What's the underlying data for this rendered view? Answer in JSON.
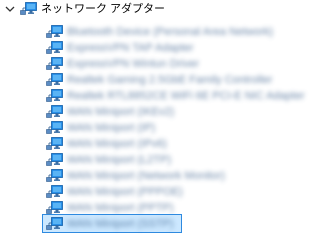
{
  "tree": {
    "root": {
      "label": "ネットワーク アダプター",
      "expanded": true,
      "icon": "network-adapter-icon"
    },
    "children": [
      {
        "label": "Bluetooth Device (Personal Area Network)",
        "icon": "network-adapter-icon",
        "selected": false
      },
      {
        "label": "ExpressVPN TAP Adapter",
        "icon": "network-adapter-icon",
        "selected": false
      },
      {
        "label": "ExpressVPN Wintun Driver",
        "icon": "network-adapter-icon",
        "selected": false
      },
      {
        "label": "Realtek Gaming 2.5GbE Family Controller",
        "icon": "network-adapter-icon",
        "selected": false
      },
      {
        "label": "Realtek RTL8852CE WiFi 6E PCI-E NIC Adapter",
        "icon": "network-adapter-icon",
        "selected": false
      },
      {
        "label": "WAN Miniport (IKEv2)",
        "icon": "network-adapter-icon",
        "selected": false
      },
      {
        "label": "WAN Miniport (IP)",
        "icon": "network-adapter-icon",
        "selected": false
      },
      {
        "label": "WAN Miniport (IPv6)",
        "icon": "network-adapter-icon",
        "selected": false
      },
      {
        "label": "WAN Miniport (L2TP)",
        "icon": "network-adapter-icon",
        "selected": false
      },
      {
        "label": "WAN Miniport (Network Monitor)",
        "icon": "network-adapter-icon",
        "selected": false
      },
      {
        "label": "WAN Miniport (PPPOE)",
        "icon": "network-adapter-icon",
        "selected": false
      },
      {
        "label": "WAN Miniport (PPTP)",
        "icon": "network-adapter-icon",
        "selected": false
      },
      {
        "label": "WAN Miniport (SSTP)",
        "icon": "network-adapter-icon",
        "selected": true
      }
    ],
    "colors": {
      "selection_fill": "#cce8ff",
      "selection_border": "#2e8ae0",
      "icon_monitor": "#1e88e5",
      "icon_cable": "#3a6ea5"
    }
  }
}
